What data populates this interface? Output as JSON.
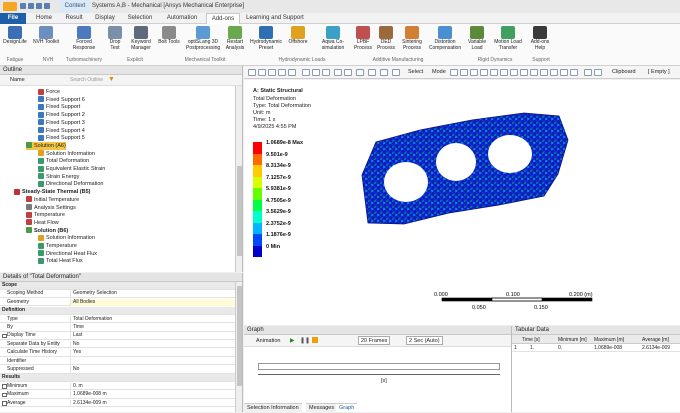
{
  "titlebar": {
    "context_tab": "Context",
    "title": "Systems A,B - Mechanical [Ansys Mechanical Enterprise]"
  },
  "tabs": [
    "File",
    "Home",
    "Result",
    "Display",
    "Selection",
    "Automation",
    "Add-ons",
    "Learning and Support"
  ],
  "active_tab": "Add-ons",
  "ribbon": {
    "buttons": [
      {
        "label": "DesignLife",
        "icon": "designlife-icon",
        "color": "#3a6fb5"
      },
      {
        "label": "NVH Toolkit",
        "icon": "nvh-icon",
        "color": "#6c8fc0"
      },
      {
        "label": "Forced Response",
        "icon": "forced-response-icon",
        "color": "#4d7abf"
      },
      {
        "label": "Drop Test",
        "icon": "drop-test-icon",
        "color": "#7a8fa8"
      },
      {
        "label": "Keyword Manager",
        "icon": "keyword-manager-icon",
        "color": "#5d6b7d"
      },
      {
        "label": "Bolt Tools",
        "icon": "bolt-icon",
        "color": "#8a8a8a"
      },
      {
        "label": "optiSLang 3D Postprocessing",
        "icon": "optislang-icon",
        "color": "#5b9bd5"
      },
      {
        "label": "Restart Analysis",
        "icon": "restart-icon",
        "color": "#6aa84f"
      },
      {
        "label": "Hydrodynamic Preset",
        "icon": "hydrodynamic-icon",
        "color": "#2d6fb0"
      },
      {
        "label": "Offshore",
        "icon": "offshore-icon",
        "color": "#e0a020"
      },
      {
        "label": "Aqwa Co-simulation",
        "icon": "aqwa-icon",
        "color": "#3aa0c8"
      },
      {
        "label": "LPBF Process",
        "icon": "lpbf-icon",
        "color": "#c05050"
      },
      {
        "label": "DED Process",
        "icon": "ded-icon",
        "color": "#9a6a3a"
      },
      {
        "label": "Sintering Process",
        "icon": "sintering-icon",
        "color": "#d08030"
      },
      {
        "label": "Distortion Compensation",
        "icon": "distortion-icon",
        "color": "#4a8fd0"
      },
      {
        "label": "Variable Load",
        "icon": "variable-load-icon",
        "color": "#5a8a3a"
      },
      {
        "label": "Motion Load Transfer",
        "icon": "motion-load-icon",
        "color": "#40a060"
      },
      {
        "label": "Add-ons Help",
        "icon": "help-icon",
        "color": "#3a3a3a"
      }
    ],
    "groups": [
      "Fatigue",
      "NVH",
      "Turbomachinery",
      "Explicit",
      "Mechanical Toolkit",
      "Hydrodynamic Loads",
      "Additive Manufacturing",
      "Rigid Dynamics",
      "Support"
    ]
  },
  "outline": {
    "title": "Outline",
    "name_label": "Name",
    "search_placeholder": "Search Outline",
    "items": [
      {
        "label": "Force",
        "level": 4,
        "color": "#c04040"
      },
      {
        "label": "Fixed Support 6",
        "level": 4,
        "color": "#3a78c0"
      },
      {
        "label": "Fixed Support",
        "level": 4,
        "color": "#3a78c0"
      },
      {
        "label": "Fixed Support 2",
        "level": 4,
        "color": "#3a78c0"
      },
      {
        "label": "Fixed Support 3",
        "level": 4,
        "color": "#3a78c0"
      },
      {
        "label": "Fixed Support 4",
        "level": 4,
        "color": "#3a78c0"
      },
      {
        "label": "Fixed Support 5",
        "level": 4,
        "color": "#3a78c0"
      },
      {
        "label": "Solution (A6)",
        "level": 3,
        "color": "#4a9a4a",
        "selected": true
      },
      {
        "label": "Solution Information",
        "level": 4,
        "color": "#e0a020"
      },
      {
        "label": "Total Deformation",
        "level": 4,
        "color": "#3a9a6a"
      },
      {
        "label": "Equivalent Elastic Strain",
        "level": 4,
        "color": "#3a9a6a"
      },
      {
        "label": "Strain Energy",
        "level": 4,
        "color": "#3a9a6a"
      },
      {
        "label": "Directional Deformation",
        "level": 4,
        "color": "#3a9a6a"
      },
      {
        "label": "Steady-State Thermal (B5)",
        "level": 2,
        "color": "#c03030",
        "bold": true
      },
      {
        "label": "Initial Temperature",
        "level": 3,
        "color": "#c04040"
      },
      {
        "label": "Analysis Settings",
        "level": 3,
        "color": "#7a7a7a"
      },
      {
        "label": "Temperature",
        "level": 3,
        "color": "#c04040"
      },
      {
        "label": "Heat Flow",
        "level": 3,
        "color": "#c04040"
      },
      {
        "label": "Solution (B6)",
        "level": 3,
        "color": "#4a9a4a",
        "bold": true
      },
      {
        "label": "Solution Information",
        "level": 4,
        "color": "#e0a020"
      },
      {
        "label": "Temperature",
        "level": 4,
        "color": "#3a9a6a"
      },
      {
        "label": "Directional Heat Flux",
        "level": 4,
        "color": "#3a9a6a"
      },
      {
        "label": "Total Heat Flux",
        "level": 4,
        "color": "#3a9a6a"
      }
    ]
  },
  "details": {
    "title": "Details of \"Total Deformation\"",
    "rows": [
      {
        "k": "Scope",
        "v": "",
        "type": "sec"
      },
      {
        "k": "Scoping Method",
        "v": "Geometry Selection"
      },
      {
        "k": "Geometry",
        "v": "All Bodies",
        "type": "yel"
      },
      {
        "k": "Definition",
        "v": "",
        "type": "sec"
      },
      {
        "k": "Type",
        "v": "Total Deformation"
      },
      {
        "k": "By",
        "v": "Time"
      },
      {
        "k": "Display Time",
        "v": "Last",
        "type": "cb"
      },
      {
        "k": "Separate Data by Entity",
        "v": "No"
      },
      {
        "k": "Calculate Time History",
        "v": "Yes"
      },
      {
        "k": "Identifier",
        "v": ""
      },
      {
        "k": "Suppressed",
        "v": "No"
      },
      {
        "k": "Results",
        "v": "",
        "type": "sec"
      },
      {
        "k": "Minimum",
        "v": "0. m",
        "type": "cb"
      },
      {
        "k": "Maximum",
        "v": "1.0689e-008 m",
        "type": "cb"
      },
      {
        "k": "Average",
        "v": "2.6134e-009 m",
        "type": "cb"
      }
    ]
  },
  "viewport": {
    "select_label": "Select",
    "mode_label": "Mode",
    "clipboard_label": "Clipboard",
    "empty_label": "[ Empty ]",
    "info": {
      "title": "A: Static Structural",
      "line1": "Total Deformation",
      "line2": "Type: Total Deformation",
      "line3": "Unit: m",
      "line4": "Time: 1 s",
      "line5": "4/9/2025 4:55 PM"
    },
    "legend": [
      {
        "label": "1.0689e-8 Max",
        "color": "#ff0000"
      },
      {
        "label": "9.501e-9",
        "color": "#ff6a00"
      },
      {
        "label": "8.3134e-9",
        "color": "#ffcc00"
      },
      {
        "label": "7.1257e-9",
        "color": "#d8ff00"
      },
      {
        "label": "5.9381e-9",
        "color": "#66ff00"
      },
      {
        "label": "4.7505e-9",
        "color": "#00ff44"
      },
      {
        "label": "3.5629e-9",
        "color": "#00ffcc"
      },
      {
        "label": "2.3752e-9",
        "color": "#00b4ff"
      },
      {
        "label": "1.1876e-9",
        "color": "#0048ff"
      },
      {
        "label": "0 Min",
        "color": "#0000cc"
      }
    ],
    "scale": {
      "l0": "0.000",
      "l1": "0.100",
      "l2": "0.200 (m)",
      "m1": "0.050",
      "m2": "0.150"
    }
  },
  "graph": {
    "title": "Graph",
    "animation_label": "Animation",
    "frames": "20 Frames",
    "seconds": "2 Sec (Auto)",
    "axis_label": "[s]",
    "tabs": [
      "Selection Information",
      "Messages",
      "Graph"
    ]
  },
  "tabular": {
    "title": "Tabular Data",
    "headers": [
      "Time [s]",
      "Minimum [m]",
      "Maximum [m]",
      "Average [m]"
    ],
    "row": [
      "1",
      "1.",
      "0.",
      "1.0689e-008",
      "2.6134e-009"
    ]
  }
}
